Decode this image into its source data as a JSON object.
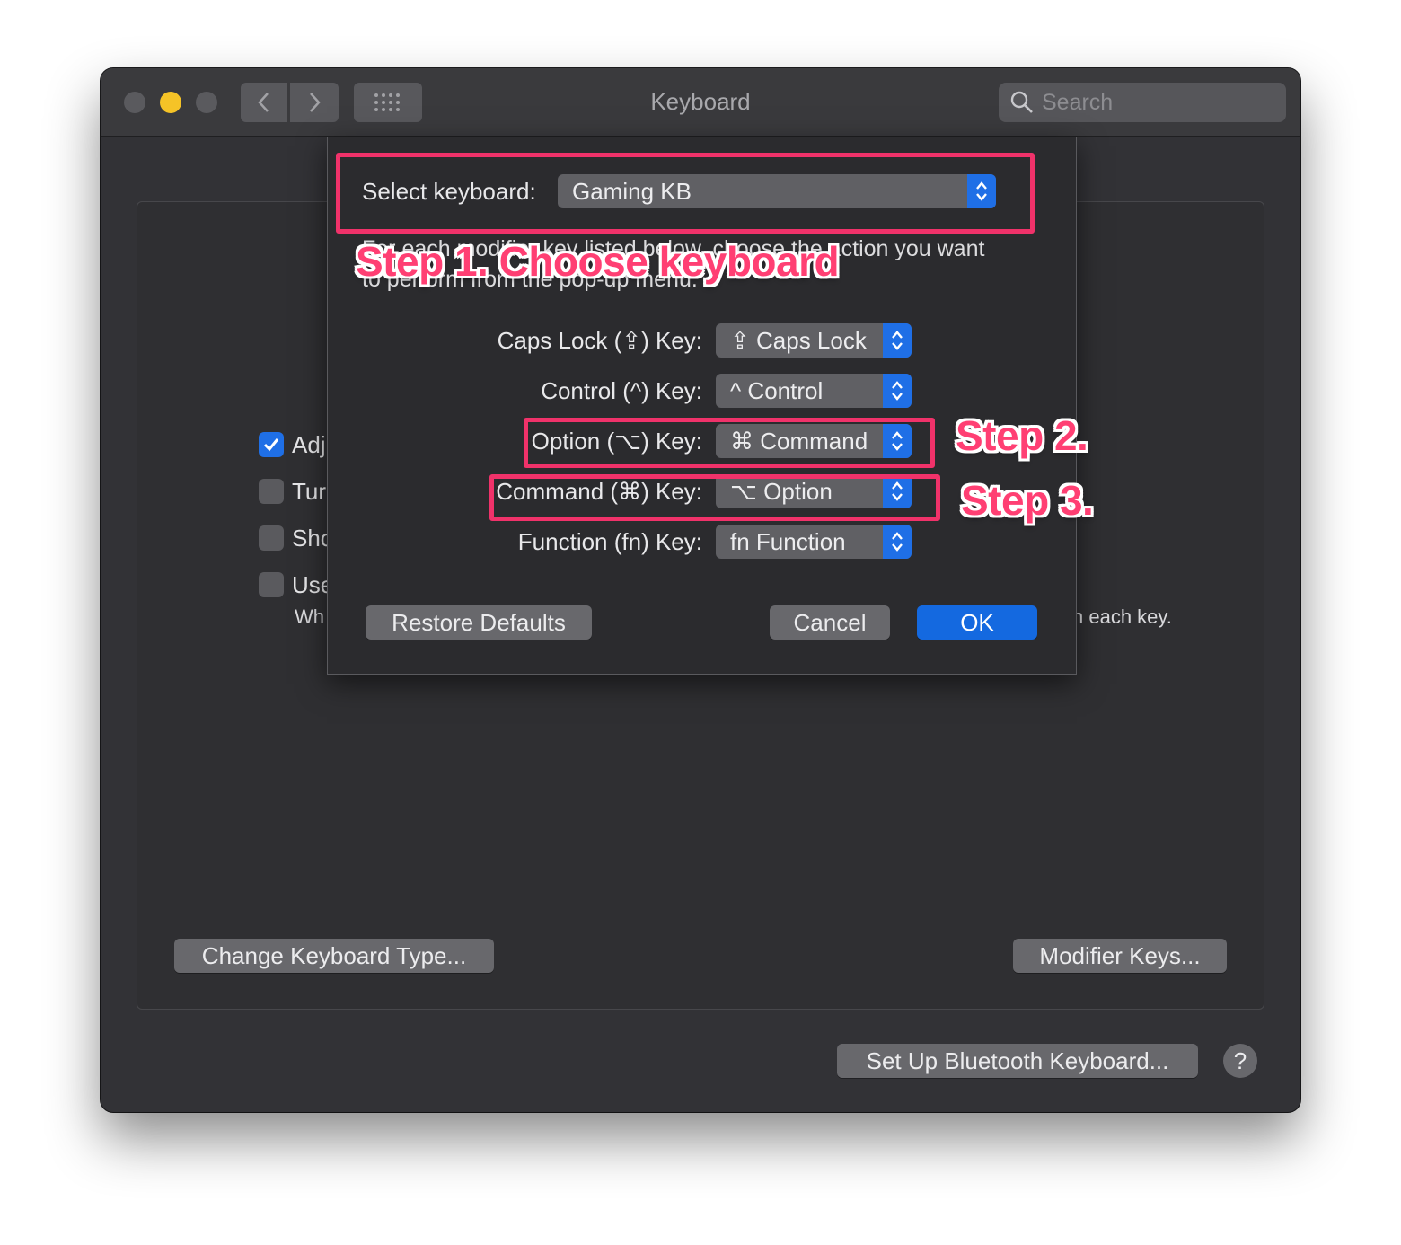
{
  "window": {
    "title": "Keyboard"
  },
  "toolbar": {
    "back_icon": "chevron-left-icon",
    "forward_icon": "chevron-right-icon",
    "grid_icon": "show-all-grid-icon",
    "search_placeholder": "Search"
  },
  "traffic_lights": {
    "close": "#5a5a5e",
    "minimize": "#f5c327",
    "zoom": "#5a5a5e"
  },
  "background_panel": {
    "checkboxes": [
      {
        "label": "Adj",
        "checked": true
      },
      {
        "label": "Tur",
        "checked": false
      },
      {
        "label": "Sho",
        "checked": false
      },
      {
        "label": "Use",
        "checked": false
      }
    ],
    "sub_left": "Wh",
    "sub_right": "n each key.",
    "change_type_button": "Change Keyboard Type...",
    "modifier_keys_button": "Modifier Keys...",
    "bluetooth_button": "Set Up Bluetooth Keyboard...",
    "help_button": "?"
  },
  "sheet": {
    "select_label": "Select keyboard:",
    "select_value": "Gaming KB",
    "description": "For each modifier key listed below, choose the action you want to perform from the pop-up menu.",
    "rows": [
      {
        "label": "Caps Lock (⇪) Key:",
        "value": "⇪ Caps Lock"
      },
      {
        "label": "Control (^) Key:",
        "value": "^ Control"
      },
      {
        "label": "Option (⌥) Key:",
        "value": "⌘ Command"
      },
      {
        "label": "Command (⌘) Key:",
        "value": "⌥ Option"
      },
      {
        "label": "Function (fn) Key:",
        "value": "fn Function"
      }
    ],
    "restore_button": "Restore Defaults",
    "cancel_button": "Cancel",
    "ok_button": "OK"
  },
  "annotations": {
    "step1": "Step 1. Choose keyboard",
    "step2": "Step 2.",
    "step3": "Step 3.",
    "highlight_color": "#f0326a"
  },
  "colors": {
    "accent": "#1f6fe6",
    "window_bg": "#323236"
  }
}
